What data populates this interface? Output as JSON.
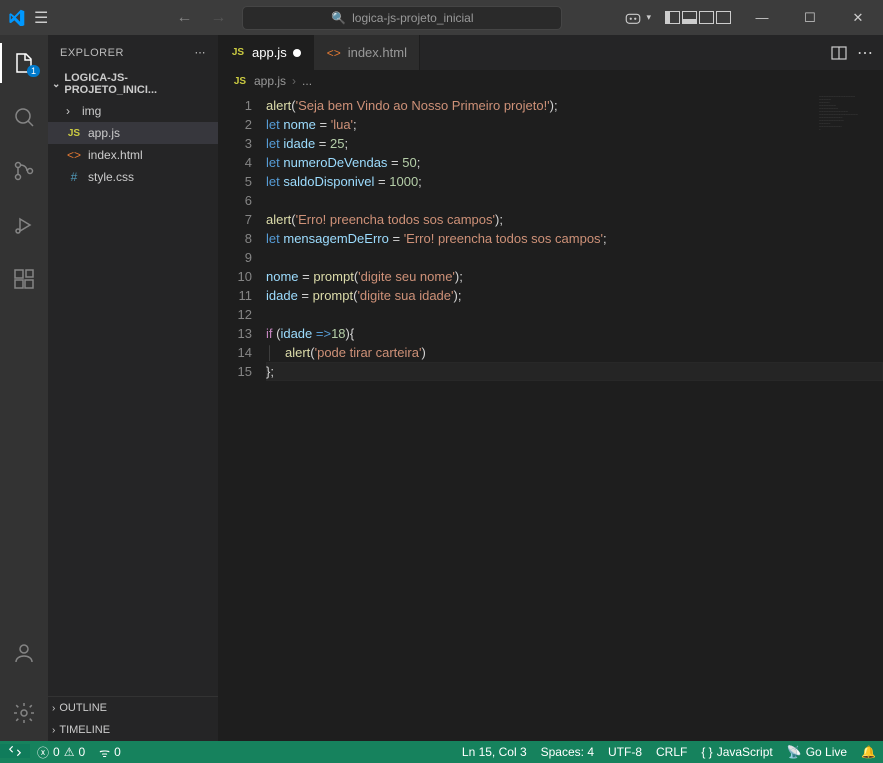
{
  "title_search": "logica-js-projeto_inicial",
  "activity_badge": "1",
  "sidebar": {
    "title": "EXPLORER",
    "project": "LOGICA-JS-PROJETO_INICI...",
    "items": [
      {
        "icon": "folder",
        "label": "img"
      },
      {
        "icon": "js",
        "label": "app.js"
      },
      {
        "icon": "html",
        "label": "index.html"
      },
      {
        "icon": "css",
        "label": "style.css"
      }
    ],
    "outline": "OUTLINE",
    "timeline": "TIMELINE"
  },
  "tabs": [
    {
      "icon": "js",
      "label": "app.js",
      "active": true,
      "dirty": true
    },
    {
      "icon": "html",
      "label": "index.html",
      "active": false,
      "dirty": false
    }
  ],
  "breadcrumb": {
    "file_icon": "js",
    "file": "app.js",
    "rest": "..."
  },
  "code": {
    "lines": [
      [
        [
          "f",
          "alert"
        ],
        [
          "p",
          "("
        ],
        [
          "s",
          "'Seja bem Vindo ao Nosso Primeiro projeto!'"
        ],
        [
          "p",
          ");"
        ]
      ],
      [
        [
          "k",
          "let"
        ],
        [
          "p",
          " "
        ],
        [
          "v",
          "nome"
        ],
        [
          "p",
          " = "
        ],
        [
          "s",
          "'lua'"
        ],
        [
          "p",
          ";"
        ]
      ],
      [
        [
          "k",
          "let"
        ],
        [
          "p",
          " "
        ],
        [
          "v",
          "idade"
        ],
        [
          "p",
          " = "
        ],
        [
          "n",
          "25"
        ],
        [
          "p",
          ";"
        ]
      ],
      [
        [
          "k",
          "let"
        ],
        [
          "p",
          " "
        ],
        [
          "v",
          "numeroDeVendas"
        ],
        [
          "p",
          " = "
        ],
        [
          "n",
          "50"
        ],
        [
          "p",
          ";"
        ]
      ],
      [
        [
          "k",
          "let"
        ],
        [
          "p",
          " "
        ],
        [
          "v",
          "saldoDisponivel"
        ],
        [
          "p",
          " = "
        ],
        [
          "n",
          "1000"
        ],
        [
          "p",
          ";"
        ]
      ],
      [],
      [
        [
          "f",
          "alert"
        ],
        [
          "p",
          "("
        ],
        [
          "s",
          "'Erro! preencha todos sos campos'"
        ],
        [
          "p",
          ");"
        ]
      ],
      [
        [
          "k",
          "let"
        ],
        [
          "p",
          " "
        ],
        [
          "v",
          "mensagemDeErro"
        ],
        [
          "p",
          " = "
        ],
        [
          "s",
          "'Erro! preencha todos sos campos'"
        ],
        [
          "p",
          ";"
        ]
      ],
      [],
      [
        [
          "v",
          "nome"
        ],
        [
          "p",
          " = "
        ],
        [
          "f",
          "prompt"
        ],
        [
          "p",
          "("
        ],
        [
          "s",
          "'digite seu nome'"
        ],
        [
          "p",
          ");"
        ]
      ],
      [
        [
          "v",
          "idade"
        ],
        [
          "p",
          " = "
        ],
        [
          "f",
          "prompt"
        ],
        [
          "p",
          "("
        ],
        [
          "s",
          "'digite sua idade'"
        ],
        [
          "p",
          ");"
        ]
      ],
      [],
      [
        [
          "kc",
          "if"
        ],
        [
          "p",
          " ("
        ],
        [
          "v",
          "idade"
        ],
        [
          "p",
          " "
        ],
        [
          "k",
          "=>"
        ],
        [
          "n",
          "18"
        ],
        [
          "p",
          "){"
        ]
      ],
      [
        [
          "guide",
          "│   "
        ],
        [
          "f",
          "alert"
        ],
        [
          "p",
          "("
        ],
        [
          "s",
          "'pode tirar carteira'"
        ],
        [
          "p",
          ")"
        ]
      ],
      [
        [
          "p",
          "};"
        ]
      ]
    ],
    "active_line": 14
  },
  "status": {
    "errors": "0",
    "warnings": "0",
    "ports": "0",
    "position": "Ln 15, Col 3",
    "spaces": "Spaces: 4",
    "encoding": "UTF-8",
    "eol": "CRLF",
    "lang": "JavaScript",
    "golive": "Go Live"
  }
}
